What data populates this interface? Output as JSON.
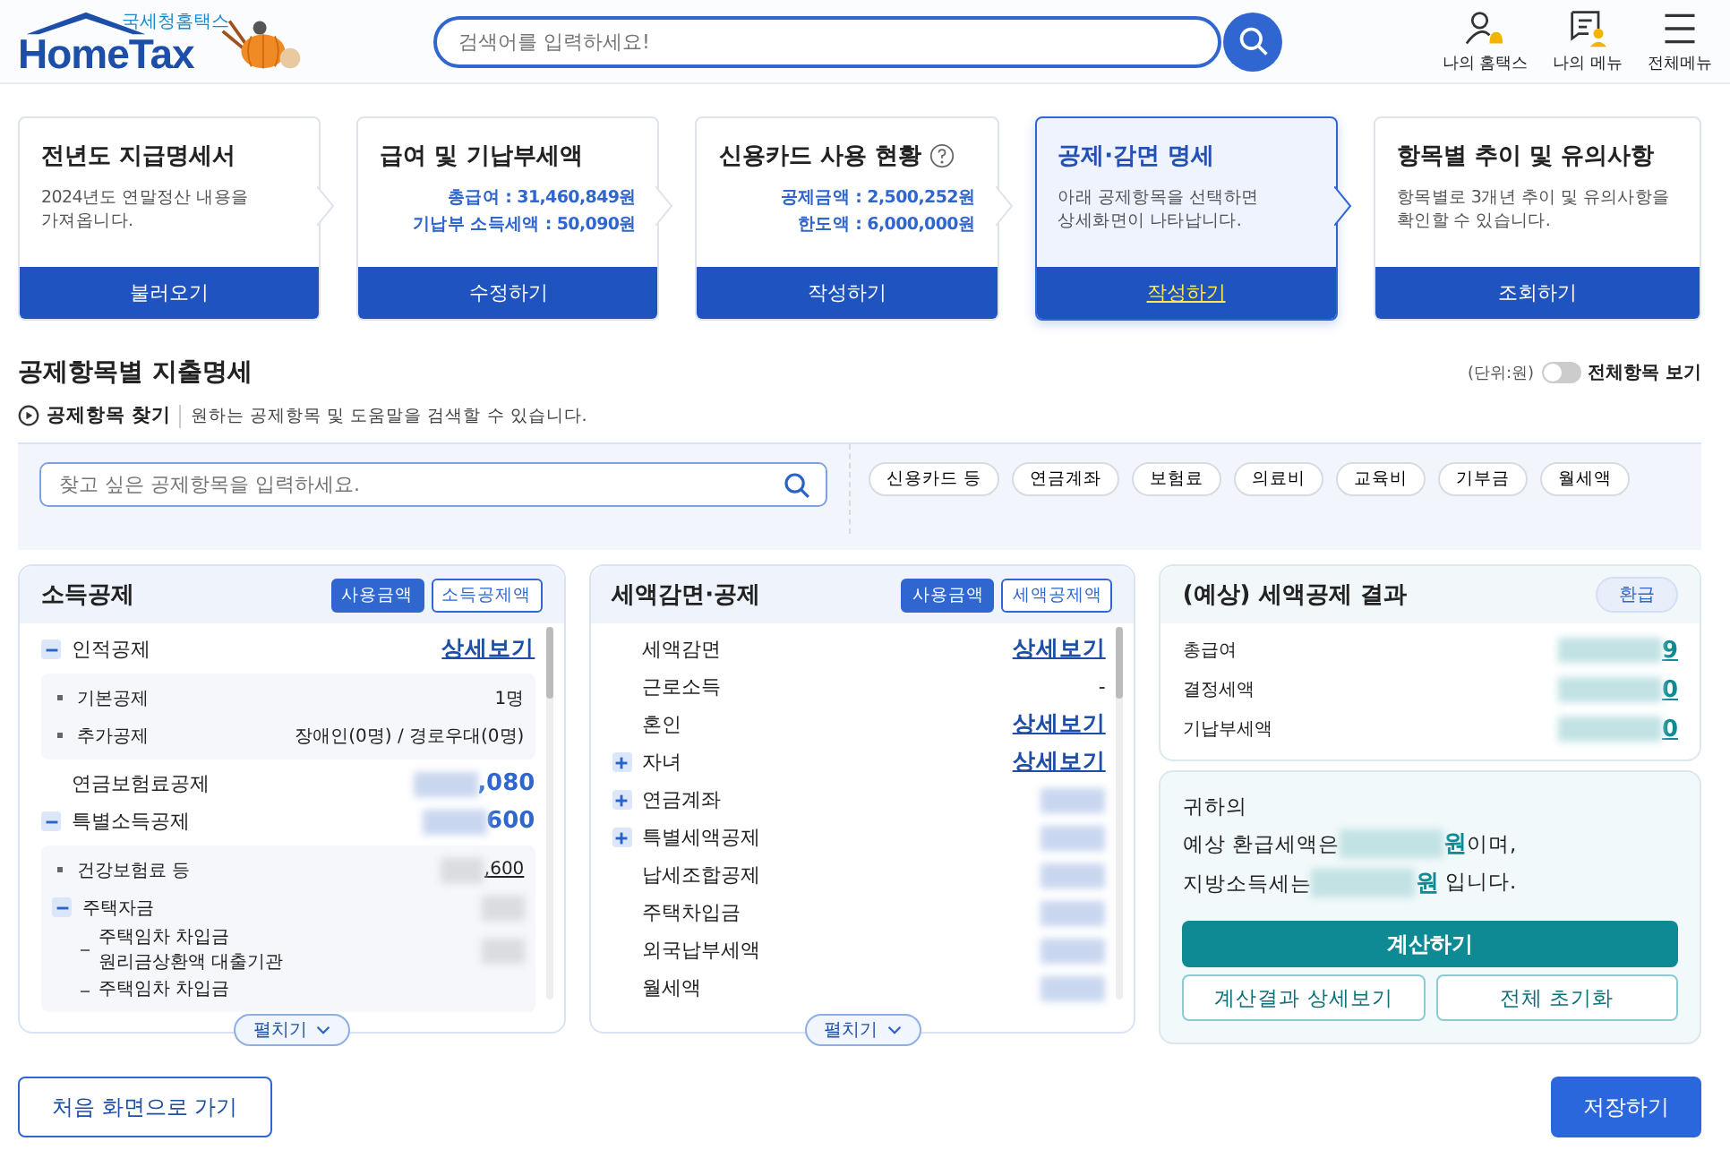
{
  "header": {
    "logo_small": "국세청홈택스",
    "logo_main": "HomeTax",
    "search_placeholder": "검색어를 입력하세요!",
    "nav": [
      {
        "kind": "my",
        "label": "나의 홈택스"
      },
      {
        "kind": "menu",
        "label": "나의 메뉴"
      },
      {
        "kind": "all",
        "label": "전체메뉴"
      }
    ]
  },
  "steps": [
    {
      "title": "전년도 지급명세서",
      "desc": "2024년도 연말정산 내용을\n가져옵니다.",
      "button": "불러오기",
      "selected": false
    },
    {
      "title": "급여 및 기납부세액",
      "lines": [
        {
          "label": "총급여 : 31,460,849원"
        },
        {
          "label": "기납부 소득세액 : 50,090원"
        }
      ],
      "button": "수정하기",
      "selected": false
    },
    {
      "title": "신용카드 사용 현황",
      "help": true,
      "lines": [
        {
          "label": "공제금액 : 2,500,252원"
        },
        {
          "label": "한도액 : 6,000,000원"
        }
      ],
      "button": "작성하기",
      "selected": false
    },
    {
      "title": "공제·감면 명세",
      "desc": "아래 공제항목을 선택하면\n상세화면이 나타납니다.",
      "button": "작성하기",
      "selected": true
    },
    {
      "title": "항목별 추이 및 유의사항",
      "desc": "항목별로 3개년 추이 및 유의사항을\n확인할 수 있습니다.",
      "button": "조회하기",
      "selected": false
    }
  ],
  "section": {
    "title": "공제항목별 지출명세",
    "unit": "(단위:원)",
    "toggle": {
      "label": "전체항목 보기",
      "on": false
    },
    "finder_label": "공제항목 찾기",
    "finder_desc": "원하는 공제항목 및 도움말을 검색할 수 있습니다.",
    "search_placeholder": "찾고 싶은 공제항목을 입력하세요.",
    "tags": [
      "신용카드 등",
      "연금계좌",
      "보험료",
      "의료비",
      "교육비",
      "기부금",
      "월세액"
    ]
  },
  "income": {
    "title": "소득공제",
    "modes": [
      {
        "label": "사용금액",
        "selected": true
      },
      {
        "label": "소득공제액",
        "selected": false
      }
    ],
    "expand": "펼치기",
    "rows": [
      {
        "label": "인적공제",
        "expanded": true,
        "value": "상세보기",
        "link": true,
        "children": [
          {
            "label": "기본공제",
            "value": "1명"
          },
          {
            "label": "추가공제",
            "value": "장애인(0명) / 경로우대(0명)"
          }
        ]
      },
      {
        "label": "연금보험료공제",
        "value": ",080",
        "blurred": true
      },
      {
        "label": "특별소득공제",
        "expanded": true,
        "value": "600",
        "blurred": true,
        "children": [
          {
            "label": "건강보험료 등",
            "value": ",600",
            "blurred": true
          },
          {
            "label": "주택자금",
            "expanded": true,
            "blurred": true,
            "children": [
              {
                "label": "주택임차 차입금\n원리금상환액 대출기관",
                "blurred": true
              },
              {
                "label": "주택임차 차입금"
              }
            ]
          }
        ]
      }
    ]
  },
  "tax": {
    "title": "세액감면·공제",
    "modes": [
      {
        "label": "사용금액",
        "selected": true
      },
      {
        "label": "세액공제액",
        "selected": false
      }
    ],
    "expand": "펼치기",
    "rows": [
      {
        "label": "세액감면",
        "value": "상세보기",
        "link": true
      },
      {
        "label": "근로소득",
        "value": "-"
      },
      {
        "label": "혼인",
        "value": "상세보기",
        "link": true
      },
      {
        "label": "자녀",
        "expanded": false,
        "value": "상세보기",
        "link": true
      },
      {
        "label": "연금계좌",
        "expanded": false,
        "blurred": true
      },
      {
        "label": "특별세액공제",
        "expanded": false,
        "blurred": true
      },
      {
        "label": "납세조합공제",
        "blurred": true
      },
      {
        "label": "주택차입금",
        "blurred": true
      },
      {
        "label": "외국납부세액",
        "blurred": true
      },
      {
        "label": "월세액",
        "blurred": true
      }
    ]
  },
  "result": {
    "title": "(예상) 세액공제 결과",
    "badge": "환급",
    "rows": [
      {
        "label": "총급여",
        "value": "9",
        "blurred": true
      },
      {
        "label": "결정세액",
        "value": "0",
        "blurred": true
      },
      {
        "label": "기납부세액",
        "value": "0",
        "blurred": true
      }
    ],
    "message": {
      "line1": "귀하의",
      "refund_prefix": "예상 환급세액은",
      "refund_unit": "원",
      "refund_suffix": "이며,",
      "local_prefix": "지방소득세는",
      "local_unit": "원",
      "local_suffix": " 입니다."
    },
    "calc_button": "계산하기",
    "buttons": [
      "계산결과 상세보기",
      "전체 초기화"
    ]
  },
  "footer": {
    "back": "처음 화면으로 가기",
    "save": "저장하기"
  }
}
